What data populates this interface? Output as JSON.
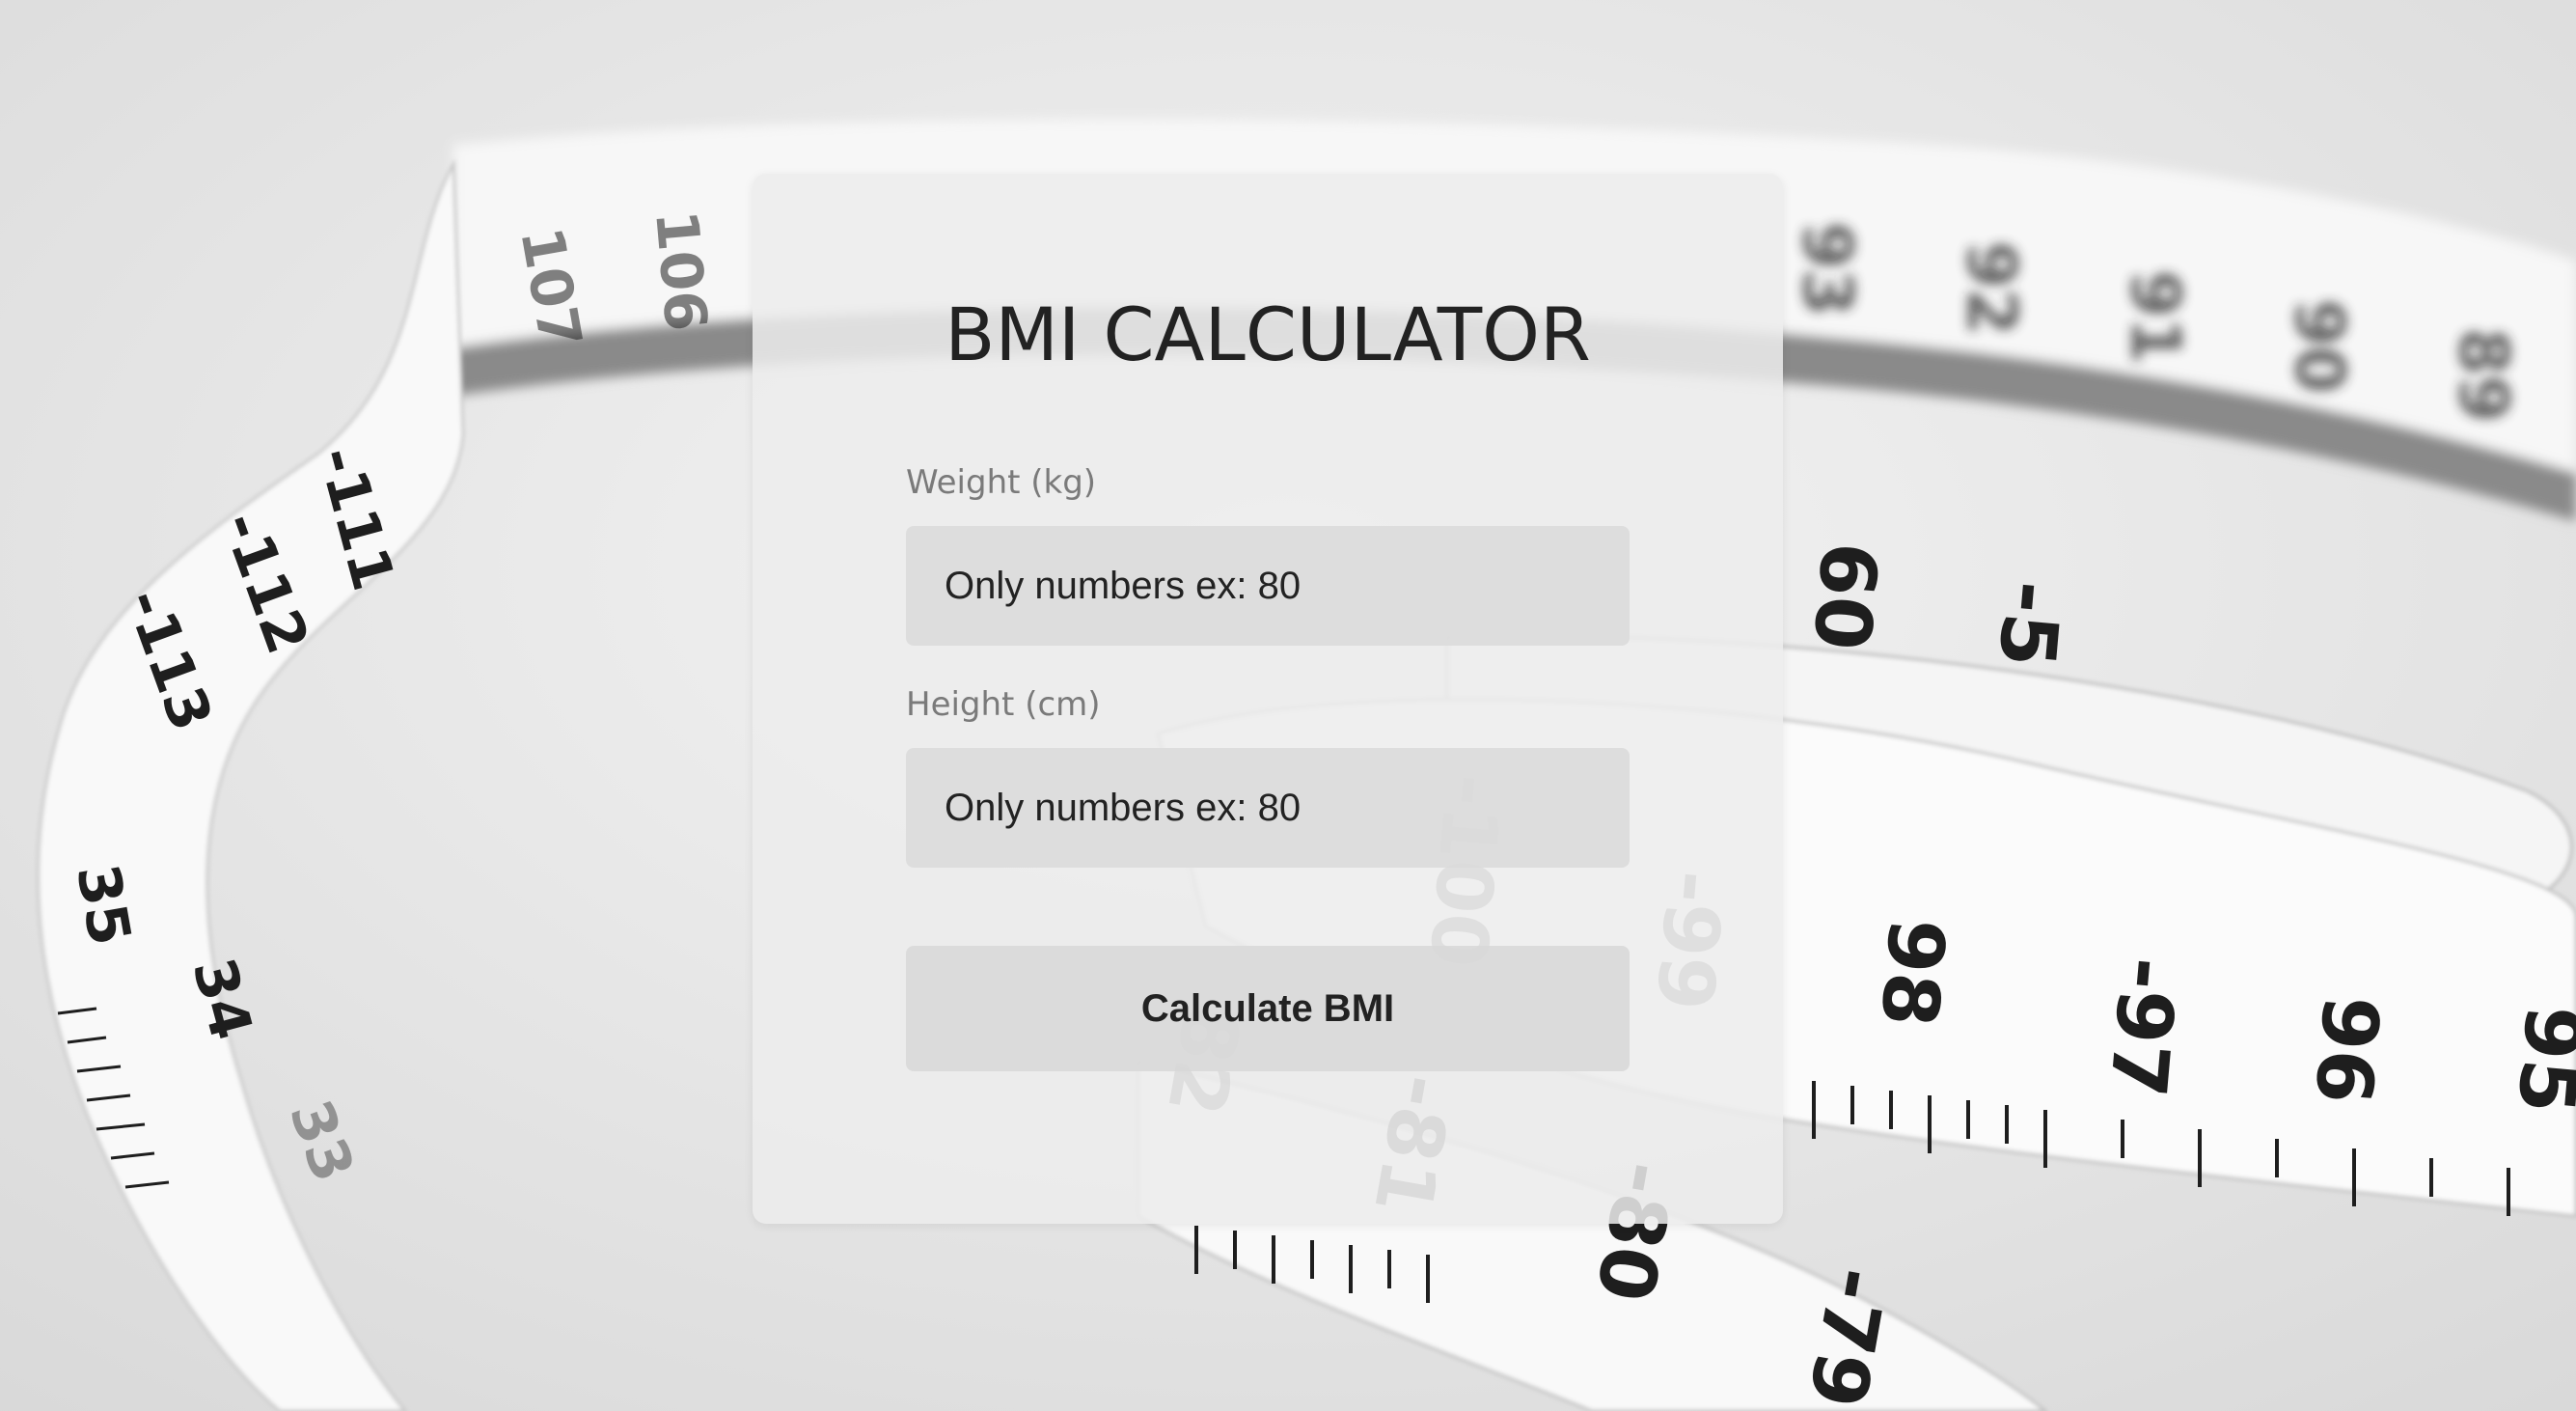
{
  "calculator": {
    "title": "BMI CALCULATOR",
    "weight_label": "Weight (kg)",
    "weight_placeholder": "Only numbers ex: 80",
    "height_label": "Height (cm)",
    "height_placeholder": "Only numbers ex: 80",
    "submit_label": "Calculate BMI"
  },
  "background": {
    "description_icon": "measuring-tape-photo",
    "tape_numbers": [
      "107",
      "106",
      "111",
      "112",
      "113",
      "35",
      "34",
      "33",
      "60",
      "5",
      "98",
      "97",
      "96",
      "95",
      "100",
      "99",
      "82",
      "81",
      "80",
      "79"
    ]
  },
  "colors": {
    "page_bg": "#e6e6e6",
    "card_bg": "#ececec",
    "text": "#222222",
    "label": "#7a7a7a",
    "field_bg": "#dadada"
  }
}
